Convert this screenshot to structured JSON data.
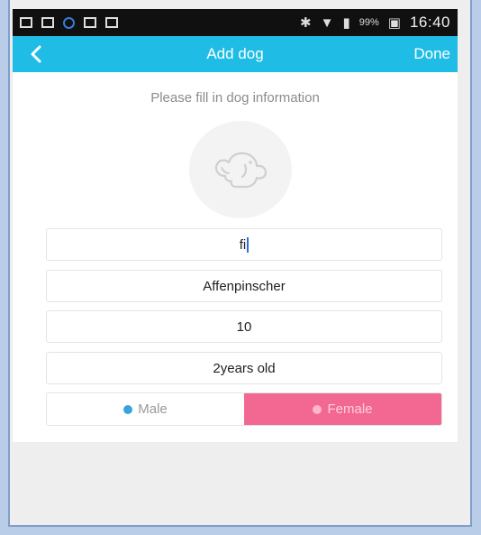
{
  "status_bar": {
    "battery": "99%",
    "time": "16:40"
  },
  "header": {
    "title": "Add dog",
    "done_label": "Done"
  },
  "form": {
    "prompt": "Please fill in dog information",
    "fields": [
      {
        "value": "fi"
      },
      {
        "value": "Affenpinscher"
      },
      {
        "value": "10"
      },
      {
        "value": "2years old"
      }
    ],
    "gender": {
      "options": [
        "Male",
        "Female"
      ],
      "selected": "Female"
    }
  },
  "colors": {
    "toolbar": "#1fbde6",
    "female_selected": "#f26892",
    "male_dot": "#3ba3dc"
  }
}
